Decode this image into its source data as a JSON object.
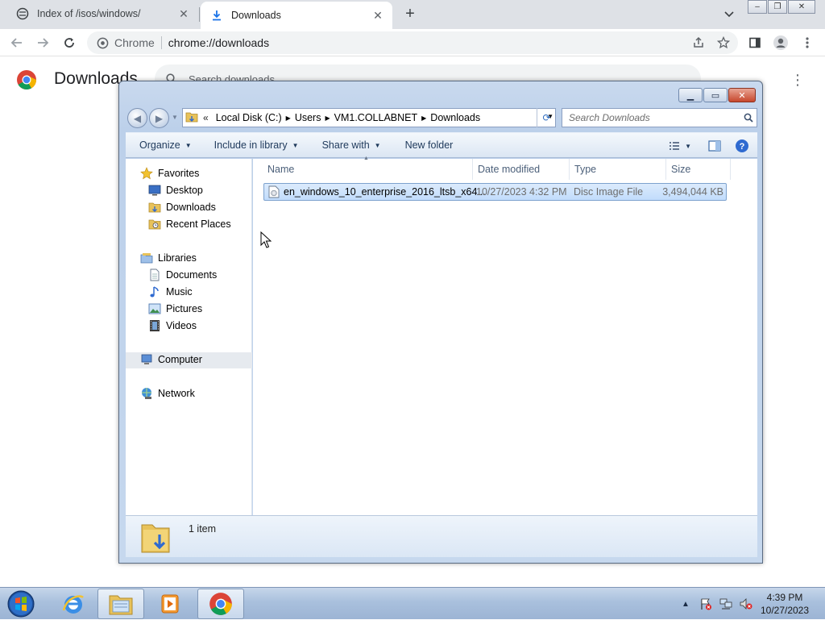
{
  "browser": {
    "tabs": [
      {
        "title": "Index of /isos/windows/",
        "active": false,
        "icon": "site-favicon"
      },
      {
        "title": "Downloads",
        "active": true,
        "icon": "download-icon"
      }
    ],
    "omnibox": {
      "chip": "Chrome",
      "url": "chrome://downloads"
    }
  },
  "downloads_page": {
    "title": "Downloads",
    "search_placeholder": "Search downloads"
  },
  "explorer": {
    "breadcrumbs": [
      "Local Disk (C:)",
      "Users",
      "VM1.COLLABNET",
      "Downloads"
    ],
    "search_placeholder": "Search Downloads",
    "commands": [
      "Organize",
      "Include in library",
      "Share with",
      "New folder"
    ],
    "nav": {
      "favorites": {
        "label": "Favorites",
        "items": [
          "Desktop",
          "Downloads",
          "Recent Places"
        ]
      },
      "libraries": {
        "label": "Libraries",
        "items": [
          "Documents",
          "Music",
          "Pictures",
          "Videos"
        ]
      },
      "computer": "Computer",
      "network": "Network"
    },
    "columns": [
      "Name",
      "Date modified",
      "Type",
      "Size"
    ],
    "files": [
      {
        "name": "en_windows_10_enterprise_2016_ltsb_x64...",
        "date": "10/27/2023 4:32 PM",
        "type": "Disc Image File",
        "size": "3,494,044 KB"
      }
    ],
    "status": "1 item"
  },
  "taskbar": {
    "apps": [
      "internet-explorer",
      "windows-explorer",
      "media-player",
      "chrome"
    ],
    "clock": {
      "time": "4:39 PM",
      "date": "10/27/2023"
    }
  },
  "colors": {
    "accent": "#1a73e8",
    "selection": "#cce8ff",
    "taskbar": "#a9c0dd"
  }
}
